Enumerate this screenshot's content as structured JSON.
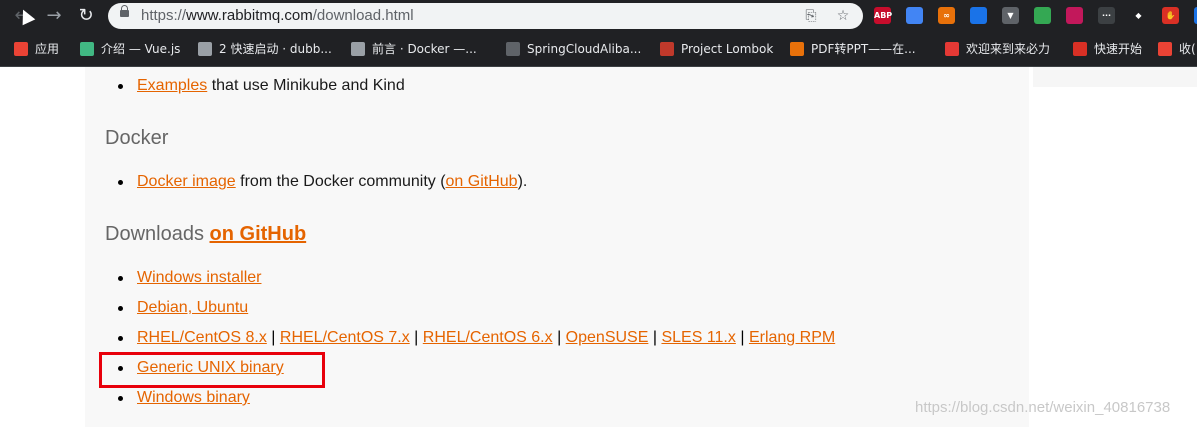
{
  "browser": {
    "url_prefix": "https://",
    "url_host": "www.rabbitmq.com",
    "url_path": "/download.html",
    "extensions": [
      {
        "name": "adblock-plus-icon",
        "label": "ABP",
        "color": "#c70d2c"
      },
      {
        "name": "translate-extension-icon",
        "label": "",
        "color": "#4285f4"
      },
      {
        "name": "infinity-extension-icon",
        "label": "∞",
        "color": "#e8710a"
      },
      {
        "name": "extension-icon-4",
        "label": "",
        "color": "#1a73e8"
      },
      {
        "name": "vue-devtools-icon",
        "label": "▼",
        "color": "#5f6368"
      },
      {
        "name": "extension-icon-6",
        "label": "",
        "color": "#34a853"
      },
      {
        "name": "extension-icon-7",
        "label": "",
        "color": "#c2185b"
      },
      {
        "name": "extension-icon-8",
        "label": "···",
        "color": "#3c4043"
      },
      {
        "name": "diamond-extension-icon",
        "label": "◆",
        "color": "#202124"
      },
      {
        "name": "hand-extension-icon",
        "label": "✋",
        "color": "#d93025"
      },
      {
        "name": "extension-icon-11",
        "label": "",
        "color": "#1a73e8"
      }
    ]
  },
  "bookmarks": [
    {
      "label": "应用",
      "color": "#ea4335"
    },
    {
      "label": "介绍 — Vue.js",
      "color": "#41b883"
    },
    {
      "label": "2 快速启动 · dubb...",
      "color": "#9aa0a6"
    },
    {
      "label": "前言 · Docker —...",
      "color": "#9aa0a6"
    },
    {
      "label": "SpringCloudAliba...",
      "color": "#5f6368"
    },
    {
      "label": "Project Lombok",
      "color": "#c0392b"
    },
    {
      "label": "PDF转PPT——在...",
      "color": "#e8710a"
    },
    {
      "label": "欢迎来到来必力",
      "color": "#e53935"
    },
    {
      "label": "快速开始",
      "color": "#d93025"
    },
    {
      "label": "收(",
      "color": "#ea4335"
    }
  ],
  "page": {
    "examples_link": "Examples",
    "examples_text": " that use Minikube and Kind",
    "docker_heading": "Docker",
    "docker_image_link": "Docker image",
    "docker_text": " from the Docker community (",
    "docker_github_link": "on GitHub",
    "docker_text_end": ").",
    "downloads_heading": "Downloads ",
    "downloads_github_link": "on GitHub",
    "windows_installer": "Windows installer",
    "debian_ubuntu": "Debian, Ubuntu",
    "rpm_links": [
      "RHEL/CentOS 8.x",
      "RHEL/CentOS 7.x",
      "RHEL/CentOS 6.x",
      "OpenSUSE",
      "SLES 11.x",
      "Erlang RPM"
    ],
    "separator": "|",
    "generic_unix": "Generic UNIX binary",
    "windows_binary": "Windows binary"
  },
  "watermark": "https://blog.csdn.net/weixin_40816738"
}
